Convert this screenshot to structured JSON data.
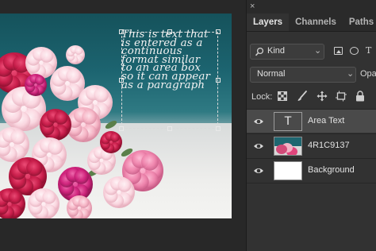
{
  "canvas": {
    "text_lines": [
      "This is text that",
      "is entered as a",
      "continuous",
      "format similar",
      "to an area box",
      "so it can appear",
      "as a paragraph"
    ]
  },
  "panel": {
    "close_glyph": "×",
    "tabs": [
      "Layers",
      "Channels",
      "Paths"
    ],
    "filter": {
      "label": "Kind",
      "icons": [
        "image-filter-icon",
        "adjustment-filter-icon",
        "type-filter-icon"
      ]
    },
    "blend_mode": "Normal",
    "opacity_label": "Opa",
    "lock": {
      "label": "Lock:",
      "icons": [
        "lock-transparent-pixels-icon",
        "lock-image-pixels-icon",
        "lock-position-icon",
        "lock-artboard-icon",
        "lock-all-icon"
      ]
    },
    "layers": [
      {
        "name": "Area Text",
        "thumb": "T",
        "kind": "text",
        "selected": true
      },
      {
        "name": "4R1C9137",
        "thumb": "",
        "kind": "photo",
        "selected": false
      },
      {
        "name": "Background",
        "thumb": "",
        "kind": "white",
        "selected": false
      }
    ]
  },
  "colors": {
    "panel_bg": "#323232",
    "selected_row": "#4a4a4a",
    "canvas_teal": "#1c6470",
    "text_color": "#f2f2f2"
  }
}
